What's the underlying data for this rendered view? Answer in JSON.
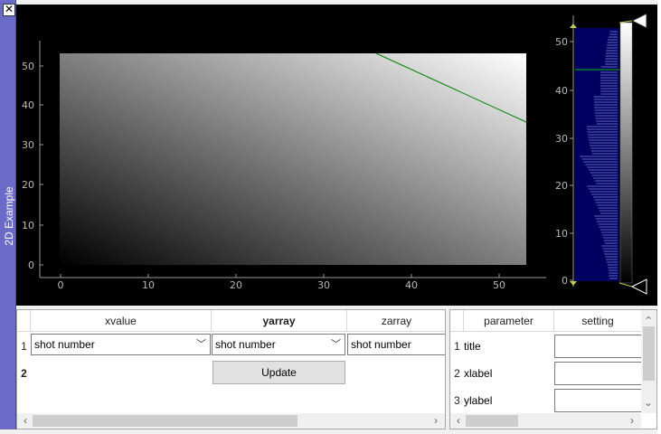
{
  "dock": {
    "title": "2D Example",
    "close_glyph": "✕"
  },
  "image_view": {
    "x_ticks": [
      "0",
      "10",
      "20",
      "30",
      "40",
      "50"
    ],
    "y_ticks": [
      "0",
      "10",
      "20",
      "30",
      "40",
      "50"
    ],
    "line_color": "#008000"
  },
  "histogram": {
    "y_ticks": [
      "0",
      "10",
      "20",
      "30",
      "40",
      "50"
    ],
    "region_color": "#000060",
    "level_line_color": "#00c000"
  },
  "array_table": {
    "columns": [
      "xvalue",
      "yarray",
      "zarray"
    ],
    "row_headers": [
      "1",
      "2"
    ],
    "row1": [
      "shot number",
      "shot number",
      "shot number"
    ],
    "update_label": "Update"
  },
  "param_table": {
    "columns": [
      "parameter",
      "setting"
    ],
    "row_headers": [
      "1",
      "2",
      "3"
    ],
    "parameters": [
      "title",
      "xlabel",
      "ylabel"
    ]
  },
  "colors": {
    "dock_bar": "#6a6ac8",
    "plot_bg": "#000000"
  }
}
